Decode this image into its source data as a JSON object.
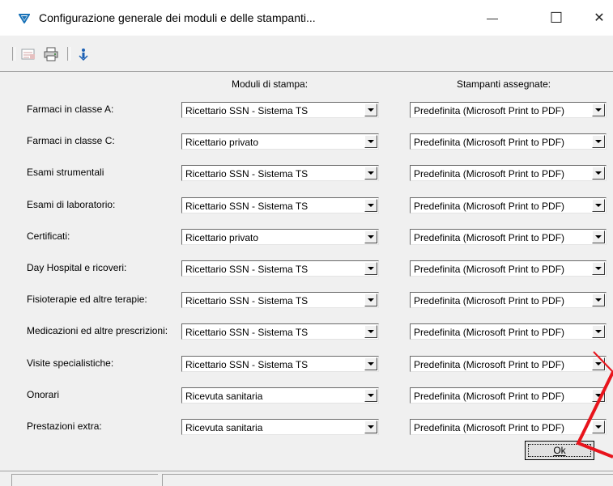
{
  "window": {
    "title": "Configurazione generale dei moduli e delle stampanti...",
    "minimize_glyph": "—",
    "maximize_glyph": "☐",
    "close_glyph": "✕"
  },
  "toolbar": {
    "icons": [
      "config-icon",
      "printer-icon",
      "info-icon"
    ]
  },
  "columns": {
    "modules": "Moduli di stampa:",
    "printers": "Stampanti assegnate:"
  },
  "rows": [
    {
      "label": "Farmaci in classe A:",
      "module": "Ricettario SSN - Sistema TS",
      "printer": "Predefinita (Microsoft Print to PDF)"
    },
    {
      "label": "Farmaci in classe C:",
      "module": "Ricettario privato",
      "printer": "Predefinita (Microsoft Print to PDF)"
    },
    {
      "label": "Esami strumentali",
      "module": "Ricettario SSN - Sistema TS",
      "printer": "Predefinita (Microsoft Print to PDF)"
    },
    {
      "label": "Esami di laboratorio:",
      "module": "Ricettario SSN - Sistema TS",
      "printer": "Predefinita (Microsoft Print to PDF)"
    },
    {
      "label": "Certificati:",
      "module": "Ricettario privato",
      "printer": "Predefinita (Microsoft Print to PDF)"
    },
    {
      "label": "Day Hospital e ricoveri:",
      "module": "Ricettario SSN - Sistema TS",
      "printer": "Predefinita (Microsoft Print to PDF)"
    },
    {
      "label": "Fisioterapie ed altre terapie:",
      "module": "Ricettario SSN - Sistema TS",
      "printer": "Predefinita (Microsoft Print to PDF)"
    },
    {
      "label": "Medicazioni ed altre prescrizioni:",
      "module": "Ricettario SSN - Sistema TS",
      "printer": "Predefinita (Microsoft Print to PDF)"
    },
    {
      "label": "Visite specialistiche:",
      "module": "Ricettario SSN - Sistema TS",
      "printer": "Predefinita (Microsoft Print to PDF)"
    },
    {
      "label": "Onorari",
      "module": "Ricevuta sanitaria",
      "printer": "Predefinita (Microsoft Print to PDF)"
    },
    {
      "label": "Prestazioni extra:",
      "module": "Ricevuta sanitaria",
      "printer": "Predefinita (Microsoft Print to PDF)"
    }
  ],
  "ok_button": {
    "label": "Ok"
  },
  "colors": {
    "annotation": "#e8141c",
    "app_icon": "#1a73b8"
  }
}
